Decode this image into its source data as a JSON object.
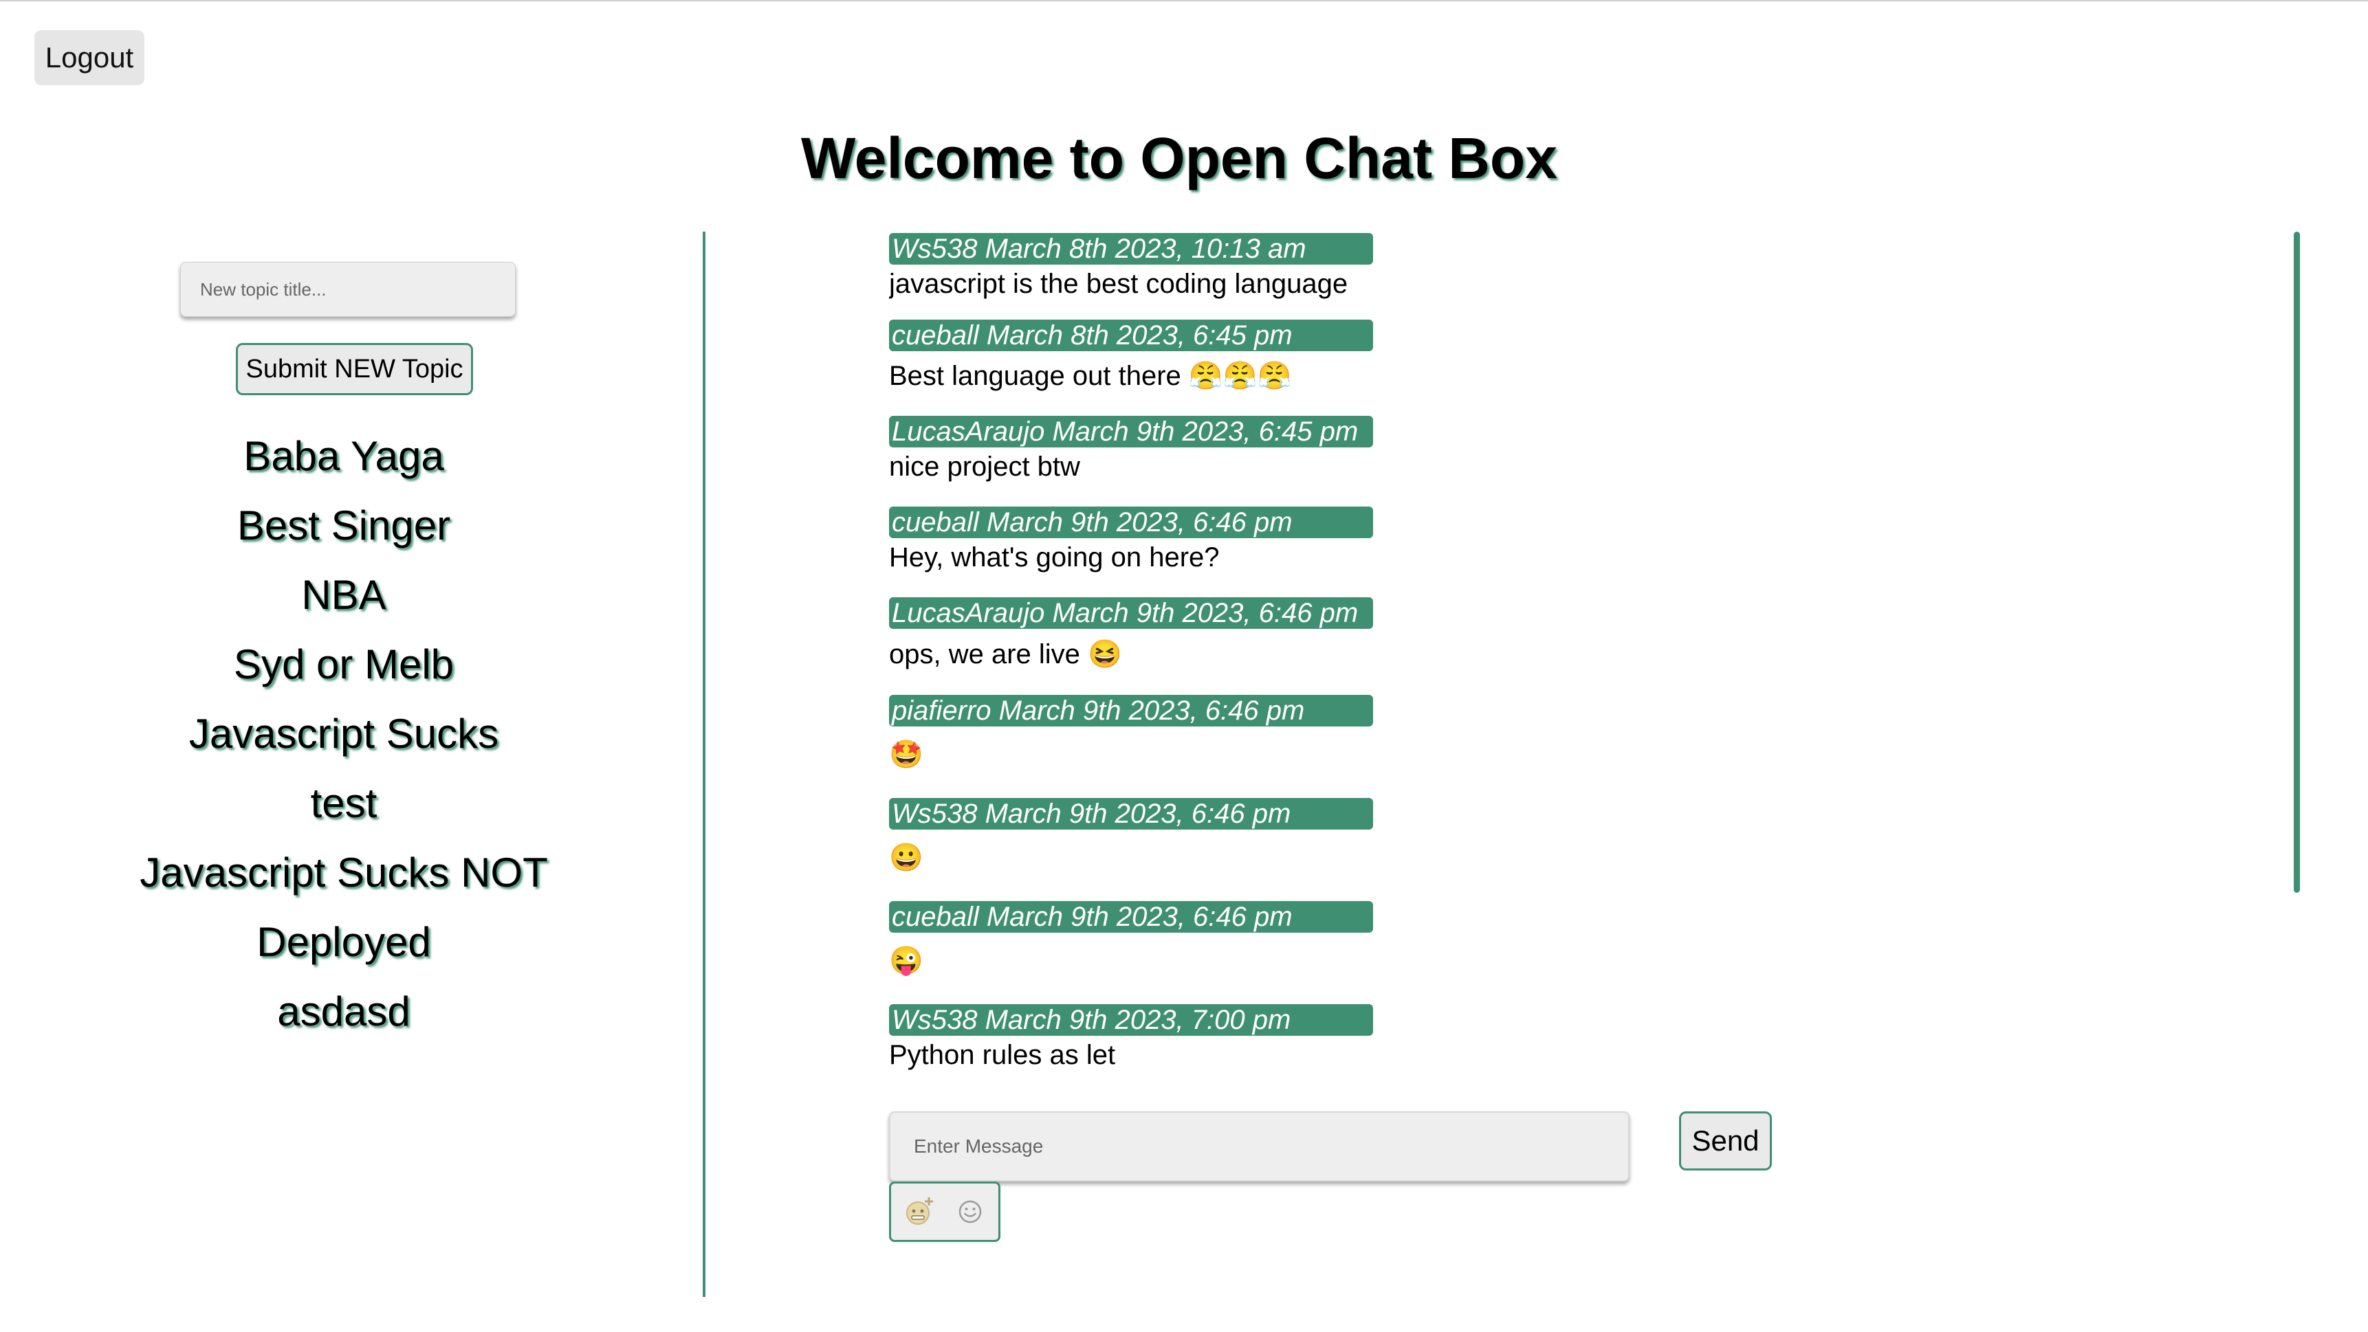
{
  "header": {
    "logout_label": "Logout",
    "title": "Welcome to Open Chat Box"
  },
  "sidebar": {
    "new_topic_placeholder": "New topic title...",
    "new_topic_value": "",
    "submit_label": "Submit NEW Topic",
    "topics": [
      "Baba Yaga",
      "Best Singer",
      "NBA",
      "Syd or Melb",
      "Javascript Sucks",
      "test",
      "Javascript Sucks NOT",
      "Deployed",
      "asdasd"
    ]
  },
  "chat": {
    "messages": [
      {
        "meta": "Ws538 March 8th 2023, 10:13 am",
        "text": "javascript is the best coding language"
      },
      {
        "meta": "cueball March 8th 2023, 6:45 pm",
        "text": "Best language out there 😤😤😤"
      },
      {
        "meta": "LucasAraujo March 9th 2023, 6:45 pm",
        "text": "nice project btw"
      },
      {
        "meta": "cueball March 9th 2023, 6:46 pm",
        "text": "Hey, what's going on here?"
      },
      {
        "meta": "LucasAraujo March 9th 2023, 6:46 pm",
        "text": "ops, we are live 😆"
      },
      {
        "meta": "piafierro March 9th 2023, 6:46 pm",
        "text": "🤩"
      },
      {
        "meta": "Ws538 March 9th 2023, 6:46 pm",
        "text": "😀"
      },
      {
        "meta": "cueball March 9th 2023, 6:46 pm",
        "text": "😜"
      },
      {
        "meta": "Ws538 March 9th 2023, 7:00 pm",
        "text": "Python rules as let"
      }
    ],
    "message_placeholder": "Enter Message",
    "message_value": "",
    "send_label": "Send",
    "tools": [
      {
        "icon": "gif-emoji-icon"
      },
      {
        "icon": "smiley-icon"
      }
    ]
  },
  "colors": {
    "accent": "#3f8f72",
    "button_bg": "#eaeaea",
    "input_bg": "#eeeeee"
  }
}
